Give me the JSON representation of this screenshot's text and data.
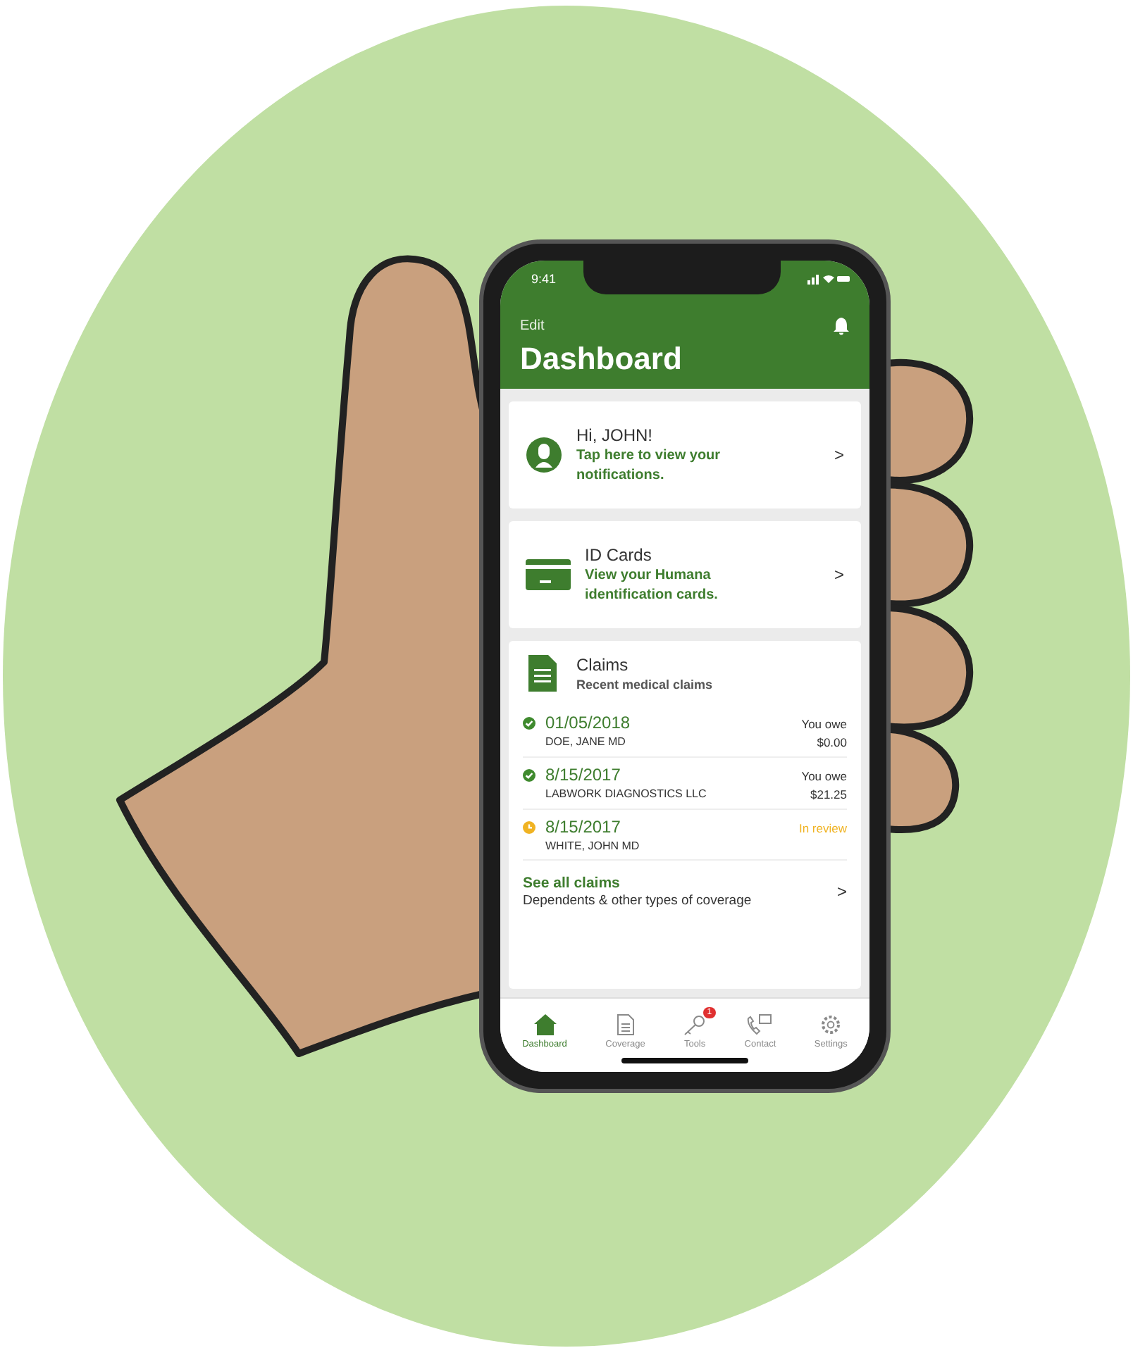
{
  "status_bar": {
    "time": "9:41"
  },
  "header": {
    "edit": "Edit",
    "title": "Dashboard"
  },
  "cards": [
    {
      "kind": "person",
      "title": "Hi, JOHN!",
      "subtitle": "Tap here to view your notifications.",
      "chevron": ">"
    },
    {
      "kind": "idcard",
      "title": "ID Cards",
      "subtitle": "View your Humana identification cards.",
      "chevron": ">"
    }
  ],
  "claims": {
    "title": "Claims",
    "subtitle": "Recent medical claims",
    "rows": [
      {
        "kind": "done",
        "date": "01/05/2018",
        "provider": "DOE, JANE MD",
        "label": "You owe",
        "amount": "$0.00"
      },
      {
        "kind": "done",
        "date": "8/15/2017",
        "provider": "LABWORK DIAGNOSTICS LLC",
        "label": "You owe",
        "amount": "$21.25"
      },
      {
        "kind": "review",
        "date": "8/15/2017",
        "provider": "WHITE, JOHN MD",
        "label": "In review"
      }
    ],
    "see_all": {
      "title": "See all claims",
      "subtitle": "Dependents & other types of coverage",
      "chevron": ">"
    }
  },
  "tab_bar": [
    {
      "kind": "home",
      "label": "Dashboard",
      "selected": true
    },
    {
      "kind": "doc",
      "label": "Coverage",
      "selected": false
    },
    {
      "kind": "key",
      "label": "Tools",
      "selected": false,
      "badge": "1"
    },
    {
      "kind": "phone",
      "label": "Contact",
      "selected": false
    },
    {
      "kind": "gear",
      "label": "Settings",
      "selected": false
    }
  ]
}
